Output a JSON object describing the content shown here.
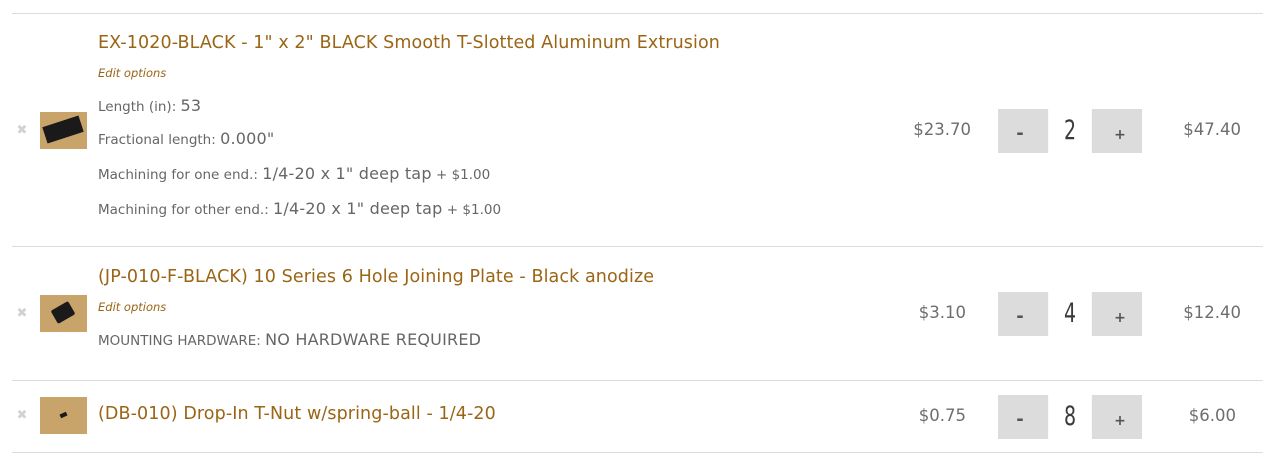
{
  "cart": {
    "remove_glyph": "✖",
    "minus_label": "-",
    "plus_label": "+",
    "items": [
      {
        "title": "EX-1020-BLACK - 1\" x 2\" BLACK Smooth T-Slotted Aluminum Extrusion",
        "edit_options": "Edit options",
        "options": [
          {
            "label": "Length (in): ",
            "value": "53",
            "extra": ""
          },
          {
            "label": "Fractional length: ",
            "value": "0.000\"",
            "extra": ""
          },
          {
            "label": "Machining for one end.: ",
            "value": "1/4-20 x 1\" deep tap",
            "extra": " + $1.00"
          },
          {
            "label": "Machining for other end.: ",
            "value": "1/4-20 x 1\" deep tap",
            "extra": " + $1.00"
          }
        ],
        "price": "$23.70",
        "quantity": "2",
        "total": "$47.40",
        "thumb_icon": "extrusion-thumbnail"
      },
      {
        "title": "(JP-010-F-BLACK) 10 Series 6 Hole Joining Plate - Black anodize",
        "edit_options": "Edit options",
        "options": [
          {
            "label": "MOUNTING HARDWARE: ",
            "value": "NO HARDWARE REQUIRED",
            "extra": ""
          }
        ],
        "price": "$3.10",
        "quantity": "4",
        "total": "$12.40",
        "thumb_icon": "joining-plate-thumbnail"
      },
      {
        "title": "(DB-010) Drop-In T-Nut w/spring-ball - 1/4-20",
        "price": "$0.75",
        "quantity": "8",
        "total": "$6.00",
        "thumb_icon": "t-nut-thumbnail"
      }
    ],
    "colors": {
      "link": "#9a6514",
      "text": "#666666",
      "thumb_bg": "#c9a46a",
      "qty_bg": "#dcdcdc"
    }
  }
}
